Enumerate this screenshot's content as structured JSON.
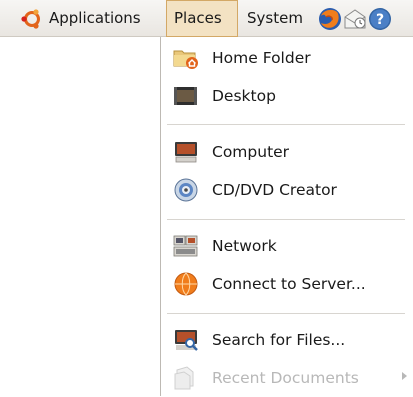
{
  "panel": {
    "applications_label": "Applications",
    "places_label": "Places",
    "system_label": "System",
    "launchers": [
      {
        "icon": "firefox-icon"
      },
      {
        "icon": "mail-icon"
      },
      {
        "icon": "help-icon"
      }
    ]
  },
  "places_menu": {
    "items": [
      {
        "label": "Home Folder",
        "icon": "home-folder-icon"
      },
      {
        "label": "Desktop",
        "icon": "desktop-icon"
      },
      {
        "label": "Computer",
        "icon": "computer-icon"
      },
      {
        "label": "CD/DVD Creator",
        "icon": "cd-dvd-icon"
      },
      {
        "label": "Network",
        "icon": "network-icon"
      },
      {
        "label": "Connect to Server...",
        "icon": "connect-server-icon"
      },
      {
        "label": "Search for Files...",
        "icon": "search-files-icon"
      },
      {
        "label": "Recent Documents",
        "icon": "recent-documents-icon",
        "disabled": true,
        "submenu": true
      }
    ]
  },
  "colors": {
    "panel_bg": "#ece9e4",
    "places_highlight": "#f3e2c3",
    "places_border": "#d3a866",
    "ubuntu_orange": "#e2641b",
    "disabled_text": "#b8b8b8"
  }
}
